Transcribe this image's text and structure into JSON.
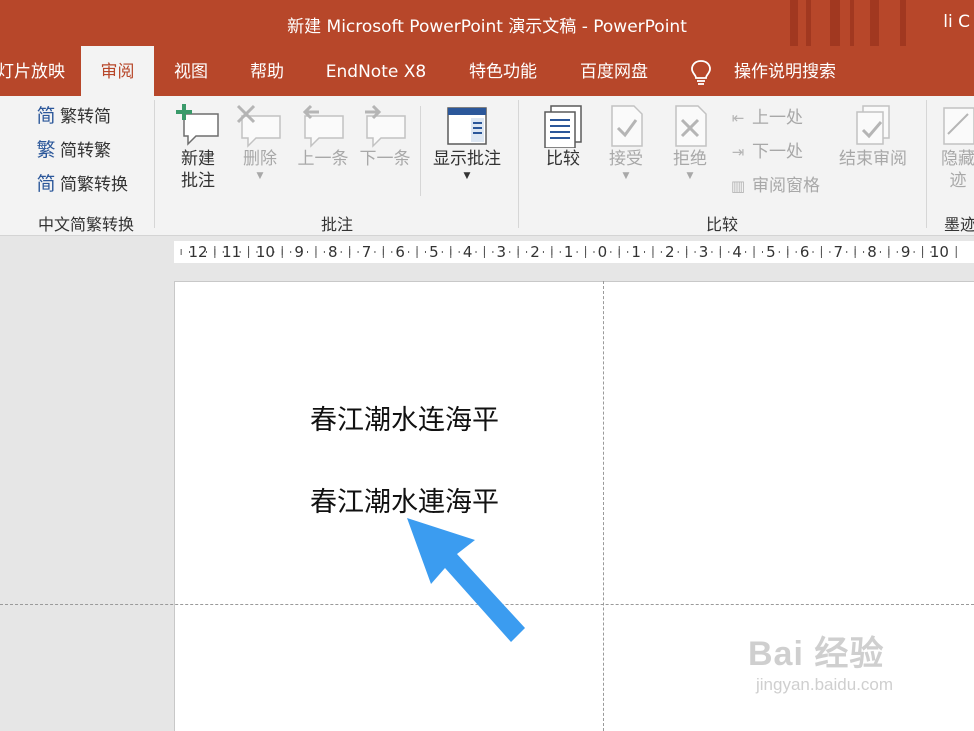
{
  "window": {
    "title": "新建 Microsoft PowerPoint 演示文稿  -  PowerPoint",
    "user": "li C"
  },
  "tabs": [
    {
      "label": "灯片放映"
    },
    {
      "label": "审阅",
      "active": true
    },
    {
      "label": "视图"
    },
    {
      "label": "帮助"
    },
    {
      "label": "EndNote X8"
    },
    {
      "label": "特色功能"
    },
    {
      "label": "百度网盘"
    },
    {
      "label": "操作说明搜索"
    }
  ],
  "ribbon": {
    "chinese_conversion": {
      "to_simplified": "繁转简",
      "to_traditional": "简转繁",
      "convert": "简繁转换",
      "group_label": "中文简繁转换"
    },
    "comments": {
      "new_comment_line1": "新建",
      "new_comment_line2": "批注",
      "delete": "删除",
      "previous": "上一条",
      "next": "下一条",
      "show_comments": "显示批注",
      "group_label": "批注"
    },
    "compare": {
      "compare": "比较",
      "accept": "接受",
      "reject": "拒绝",
      "previous_change": "上一处",
      "next_change": "下一处",
      "reviewing_pane": "审阅窗格",
      "end_review": "结束审阅",
      "group_label": "比较"
    },
    "ink": {
      "hide_line1": "隐藏",
      "hide_line2": "迹",
      "group_label": "墨迹"
    }
  },
  "ruler": {
    "labels": [
      "12",
      "11",
      "10",
      "9",
      "8",
      "7",
      "6",
      "5",
      "4",
      "3",
      "2",
      "1",
      "0",
      "1",
      "2",
      "3",
      "4",
      "5",
      "6",
      "7",
      "8",
      "9",
      "10"
    ]
  },
  "slide": {
    "line1": "春江潮水连海平",
    "line2": "春江潮水連海平"
  },
  "watermark": {
    "main": "Bai 经验",
    "sub": "jingyan.baidu.com"
  },
  "colors": {
    "accent": "#b7472a",
    "ribbon_bg": "#f3f3f3",
    "arrow": "#3b9cf0"
  }
}
